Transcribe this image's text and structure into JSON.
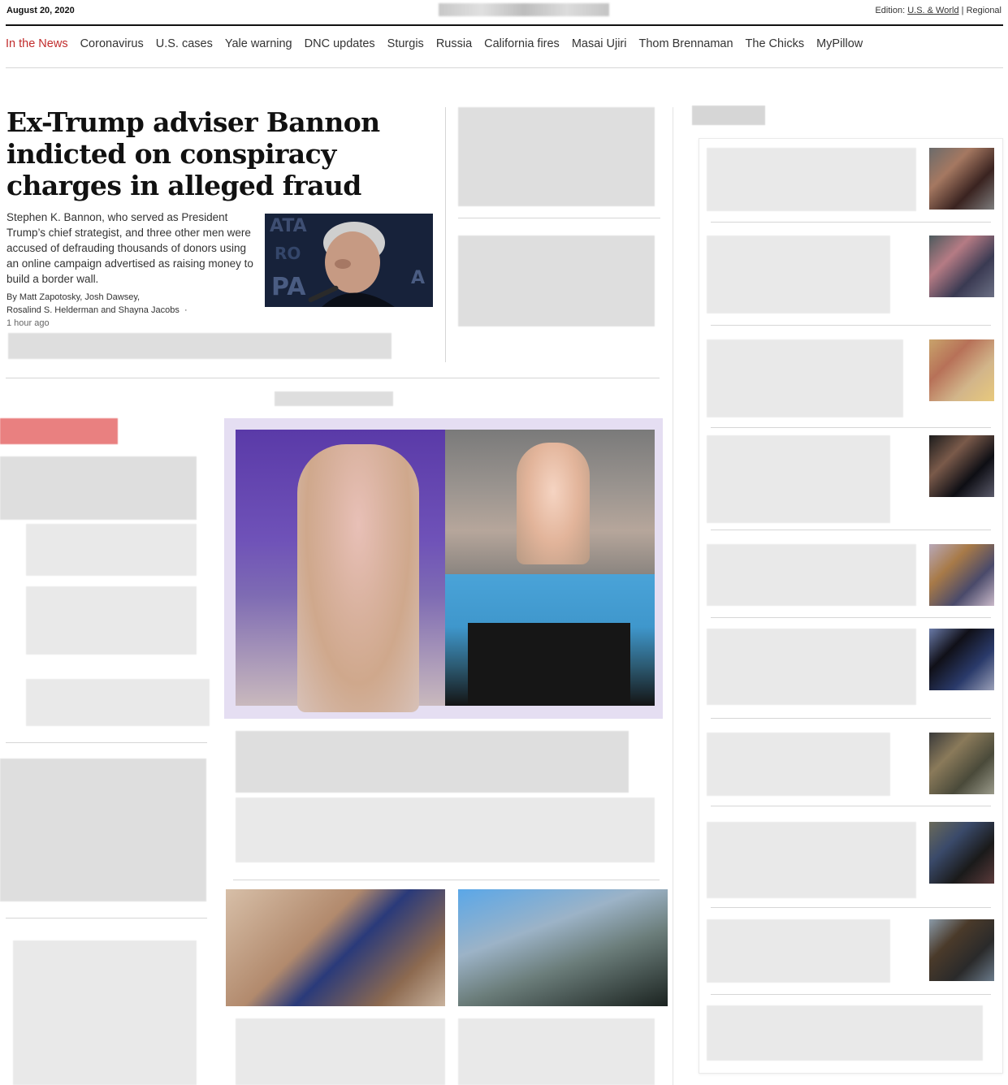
{
  "header": {
    "date": "August 20, 2020",
    "edition_label": "Edition:",
    "edition_primary": "U.S. & World",
    "edition_separator": "|",
    "edition_secondary": "Regional"
  },
  "nav": {
    "items": [
      "In the News",
      "Coronavirus",
      "U.S. cases",
      "Yale warning",
      "DNC updates",
      "Sturgis",
      "Russia",
      "California fires",
      "Masai Ujiri",
      "Thom Brennaman",
      "The Chicks",
      "MyPillow"
    ]
  },
  "lead_story": {
    "headline": "Ex-Trump adviser Bannon indicted on conspiracy charges in alleged fraud",
    "blurb": "Stephen K. Bannon, who served as President Trump’s chief strategist, and three other men were accused of defrauding thousands of donors using an online campaign advertised as raising money to build a border wall.",
    "byline_prefix": "By",
    "author1": "Matt Zapotosky",
    "author2": "Josh Dawsey",
    "author3": "Rosalind S. Helderman",
    "author_joiner": "and",
    "author4": "Shayna Jacobs",
    "bullet": "·",
    "timestamp": "1 hour ago"
  },
  "colors": {
    "accent": "#c12c2c",
    "rule": "#111111",
    "divider": "#d6d6d6"
  },
  "icons": {
    "lead_photo": "person-photo"
  }
}
